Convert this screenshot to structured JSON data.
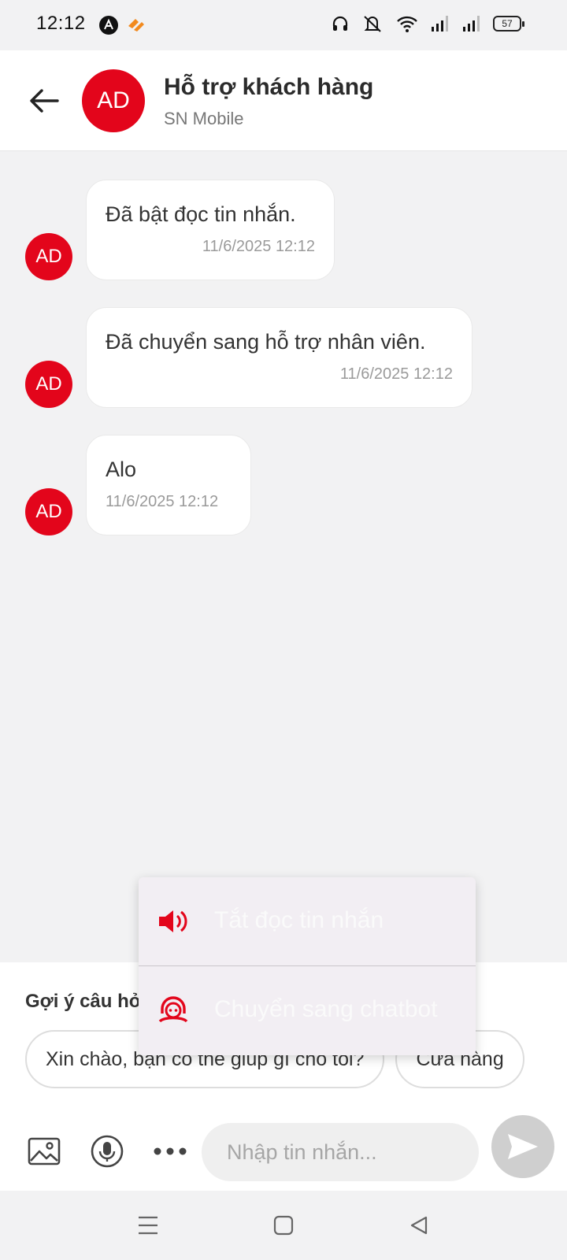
{
  "status_bar": {
    "time": "12:12",
    "battery": "57"
  },
  "header": {
    "avatar": "AD",
    "title": "Hỗ trợ khách hàng",
    "subtitle": "SN Mobile"
  },
  "messages": [
    {
      "avatar": "AD",
      "text": "Đã bật đọc tin nhắn.",
      "time": "11/6/2025 12:12"
    },
    {
      "avatar": "AD",
      "text": "Đã chuyển sang hỗ trợ nhân viên.",
      "time": "11/6/2025 12:12"
    },
    {
      "avatar": "AD",
      "text": "Alo",
      "time": "11/6/2025 12:12"
    }
  ],
  "suggestions": {
    "label": "Gợi ý câu hỏi",
    "chips": [
      "Xin chào, bạn có thể giúp gì cho tôi?",
      "Cửa hàng"
    ]
  },
  "input": {
    "placeholder": "Nhập tin nhắn..."
  },
  "popup_menu": {
    "items": [
      "Tắt đọc tin nhắn",
      "Chuyển sang chatbot"
    ]
  },
  "colors": {
    "brand": "#e3051b",
    "send_disabled": "#cfcfcf"
  },
  "icons": [
    "back-arrow-icon",
    "image-icon",
    "mic-icon",
    "more-icon",
    "send-icon",
    "speaker-icon",
    "support-agent-icon"
  ]
}
